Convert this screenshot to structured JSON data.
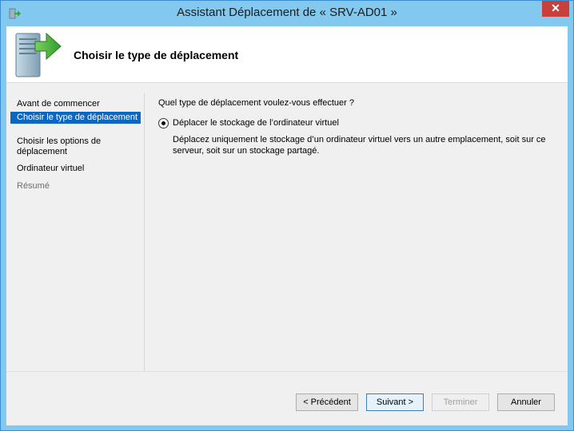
{
  "window": {
    "title": "Assistant Déplacement de « SRV-AD01 »",
    "close_label": "✕"
  },
  "header": {
    "title": "Choisir le type de déplacement"
  },
  "nav": {
    "items": [
      {
        "label": "Avant de commencer"
      },
      {
        "label": "Choisir le type de déplacement"
      },
      {
        "label": "Choisir les options de déplacement"
      },
      {
        "label": "Ordinateur virtuel"
      },
      {
        "label": "Résumé"
      }
    ]
  },
  "content": {
    "question": "Quel type de déplacement voulez-vous effectuer ?",
    "option_label": "Déplacer le stockage de l’ordinateur virtuel",
    "option_description": "Déplacez uniquement le stockage d’un ordinateur virtuel vers un autre emplacement, soit sur ce serveur, soit sur un stockage partagé."
  },
  "buttons": {
    "previous": "< Précédent",
    "next": "Suivant >",
    "finish": "Terminer",
    "cancel": "Annuler"
  }
}
